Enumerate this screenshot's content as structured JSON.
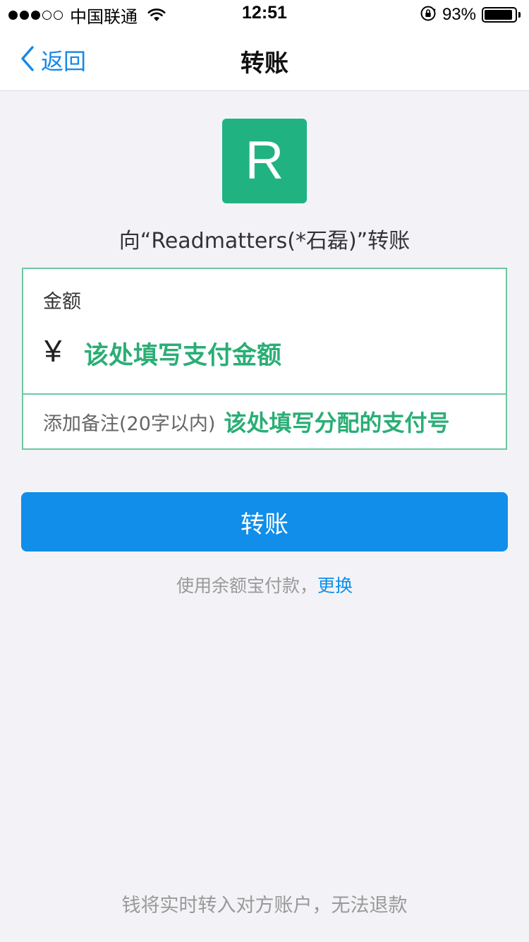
{
  "status_bar": {
    "carrier": "中国联通",
    "time": "12:51",
    "battery": "93%",
    "battery_level": 0.93,
    "signal_filled": 3,
    "signal_total": 5
  },
  "nav": {
    "back_label": "返回",
    "title": "转账"
  },
  "recipient": {
    "avatar_letter": "R",
    "avatar_color": "#20b381",
    "label": "向“Readmatters(*石磊)”转账"
  },
  "amount": {
    "label": "金额",
    "currency_symbol": "¥",
    "hint": "该处填写支付金额"
  },
  "remark": {
    "placeholder": "添加备注(20字以内)",
    "hint": "该处填写分配的支付号"
  },
  "transfer_button": {
    "label": "转账",
    "color": "#108ee9"
  },
  "payment": {
    "text": "使用余额宝付款，",
    "change_label": "更换"
  },
  "footer": {
    "note": "钱将实时转入对方账户，无法退款"
  },
  "accent_color": "#2aae75",
  "link_color": "#108ee9"
}
